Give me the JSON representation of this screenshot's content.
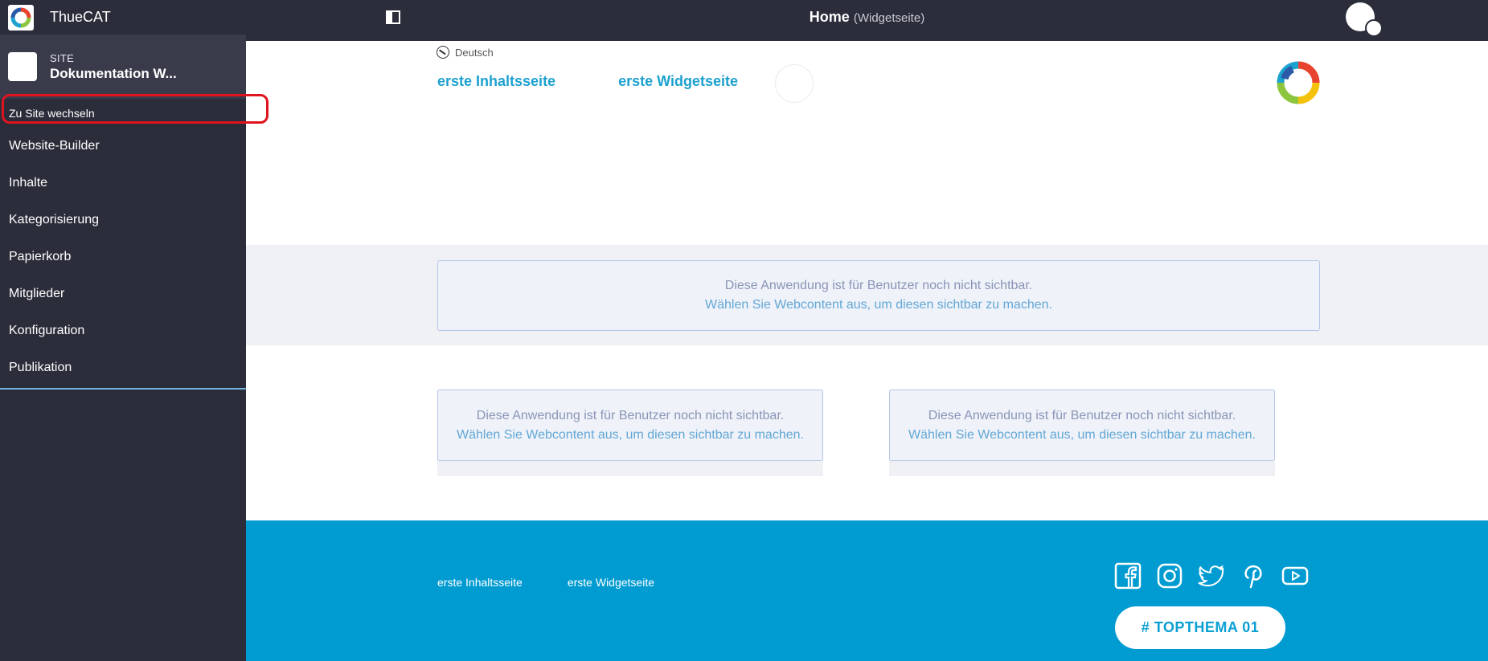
{
  "app": {
    "title": "ThueCAT"
  },
  "site": {
    "label": "SITE",
    "name": "Dokumentation W...",
    "switch_label": "Zu Site wechseln"
  },
  "sidebar": {
    "items": [
      {
        "label": "Website-Builder"
      },
      {
        "label": "Inhalte"
      },
      {
        "label": "Kategorisierung"
      },
      {
        "label": "Papierkorb"
      },
      {
        "label": "Mitglieder"
      },
      {
        "label": "Konfiguration"
      },
      {
        "label": "Publikation"
      }
    ]
  },
  "topbar": {
    "page_title": "Home",
    "page_type": "(Widgetseite)"
  },
  "header": {
    "language": "Deutsch",
    "nav": [
      {
        "label": "erste Inhaltsseite"
      },
      {
        "label": "erste Widgetseite"
      }
    ]
  },
  "notices": {
    "line1": "Diese Anwendung ist für Benutzer noch nicht sichtbar.",
    "line2": "Wählen Sie Webcontent aus, um diesen sichtbar zu machen."
  },
  "footer": {
    "links": [
      {
        "label": "erste Inhaltsseite"
      },
      {
        "label": "erste Widgetseite"
      }
    ],
    "social_icons": [
      "facebook-icon",
      "instagram-icon",
      "twitter-icon",
      "pinterest-icon",
      "youtube-icon"
    ],
    "topic_button": "# TOPTHEMA 01"
  },
  "colors": {
    "sidebar_bg": "#2b2d3b",
    "accent": "#1da1cf",
    "footer_bg": "#009bd1",
    "highlight": "#e0141e"
  }
}
